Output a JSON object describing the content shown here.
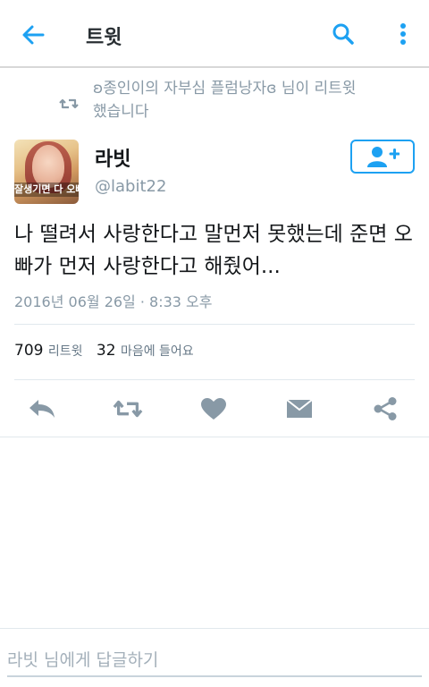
{
  "header": {
    "title": "트윗",
    "back_icon": "arrow-left-icon",
    "search_icon": "search-icon",
    "more_icon": "more-vertical-icon",
    "accent_color": "#1da1f2"
  },
  "retweet_notice": {
    "icon": "retweet-icon",
    "text": "ʚ종인이의 자부심 플럼낭자ɞ 님이 리트윗했습니다"
  },
  "tweet": {
    "author_name": "라빗",
    "author_handle": "@labit22",
    "avatar_caption": "잘생기면 다 오빠",
    "follow_icon": "add-user-icon",
    "text": "나 떨려서 사랑한다고 말먼저 못했는데 준면 오빠가 먼저 사랑한다고 해줬어...",
    "timestamp": "2016년 06월 26일 · 8:33 오후",
    "retweet_count": "709",
    "retweet_label": "리트윗",
    "like_count": "32",
    "like_label": "마음에 들어요"
  },
  "actions": [
    {
      "name": "reply",
      "icon": "reply-icon"
    },
    {
      "name": "retweet",
      "icon": "retweet-icon"
    },
    {
      "name": "like",
      "icon": "heart-icon"
    },
    {
      "name": "direct-message",
      "icon": "envelope-icon"
    },
    {
      "name": "share",
      "icon": "share-icon"
    }
  ],
  "reply_bar": {
    "placeholder": "라빗 님에게 답글하기"
  }
}
